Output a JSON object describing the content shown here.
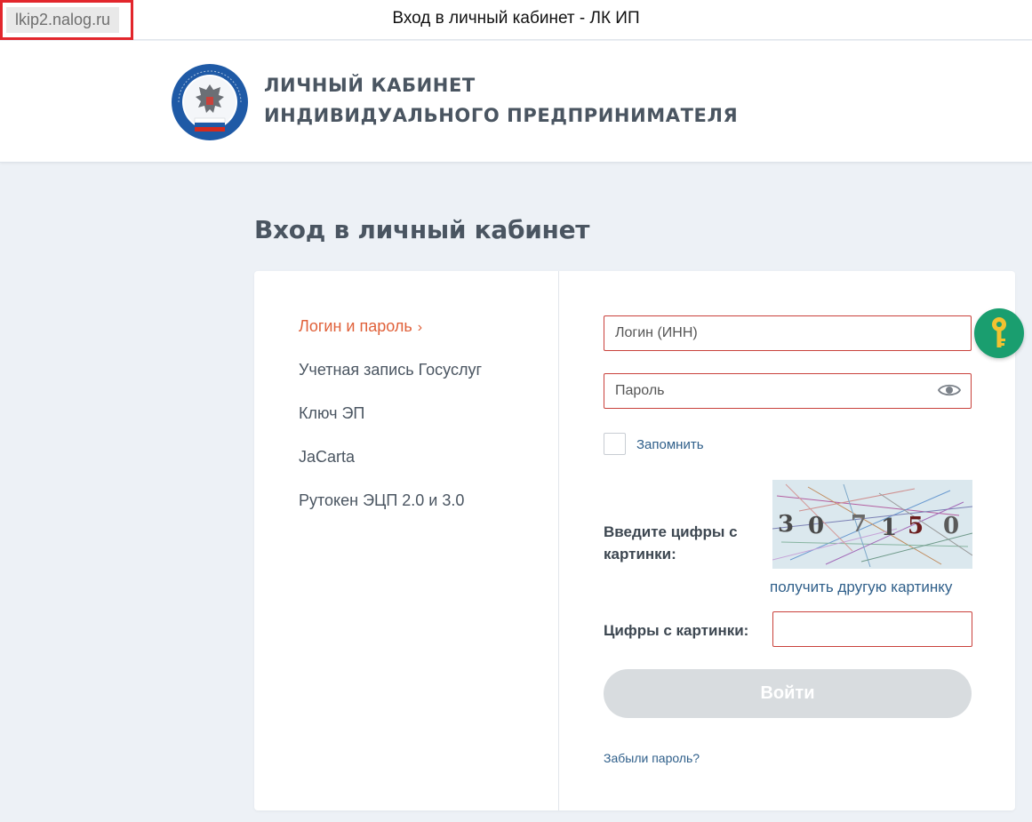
{
  "browser": {
    "url": "lkip2.nalog.ru",
    "window_title": "Вход в личный кабинет - ЛК ИП"
  },
  "header": {
    "line1": "ЛИЧНЫЙ КАБИНЕТ",
    "line2": "ИНДИВИДУАЛЬНОГО ПРЕДПРИНИМАТЕЛЯ",
    "emblem_text": "ФЕДЕРАЛЬНАЯ НАЛОГОВАЯ СЛУЖБА"
  },
  "page": {
    "title": "Вход в личный кабинет"
  },
  "menu": {
    "items": [
      {
        "label": "Логин и пароль",
        "active": true
      },
      {
        "label": "Учетная запись Госуслуг",
        "active": false
      },
      {
        "label": "Ключ ЭП",
        "active": false
      },
      {
        "label": "JaCarta",
        "active": false
      },
      {
        "label": "Рутокен ЭЦП 2.0 и 3.0",
        "active": false
      }
    ],
    "active_chevron": "›"
  },
  "form": {
    "login_placeholder": "Логин (ИНН)",
    "password_placeholder": "Пароль",
    "remember_label": "Запомнить",
    "captcha_label": "Введите цифры с картинки:",
    "captcha_code": [
      "3",
      "0",
      "7",
      "1",
      "5",
      "0"
    ],
    "captcha_refresh": "получить другую картинку",
    "code_label": "Цифры с картинки:",
    "submit_label": "Войти",
    "forgot_label": "Забыли пароль?"
  },
  "icons": {
    "eye": "eye-icon",
    "key": "key-icon",
    "emblem": "emblem-icon"
  },
  "colors": {
    "accent": "#e0613a",
    "link": "#2f5f8a",
    "field_border": "#c9413b",
    "fab": "#1a9e6f",
    "button_disabled": "#d8dcdf"
  }
}
